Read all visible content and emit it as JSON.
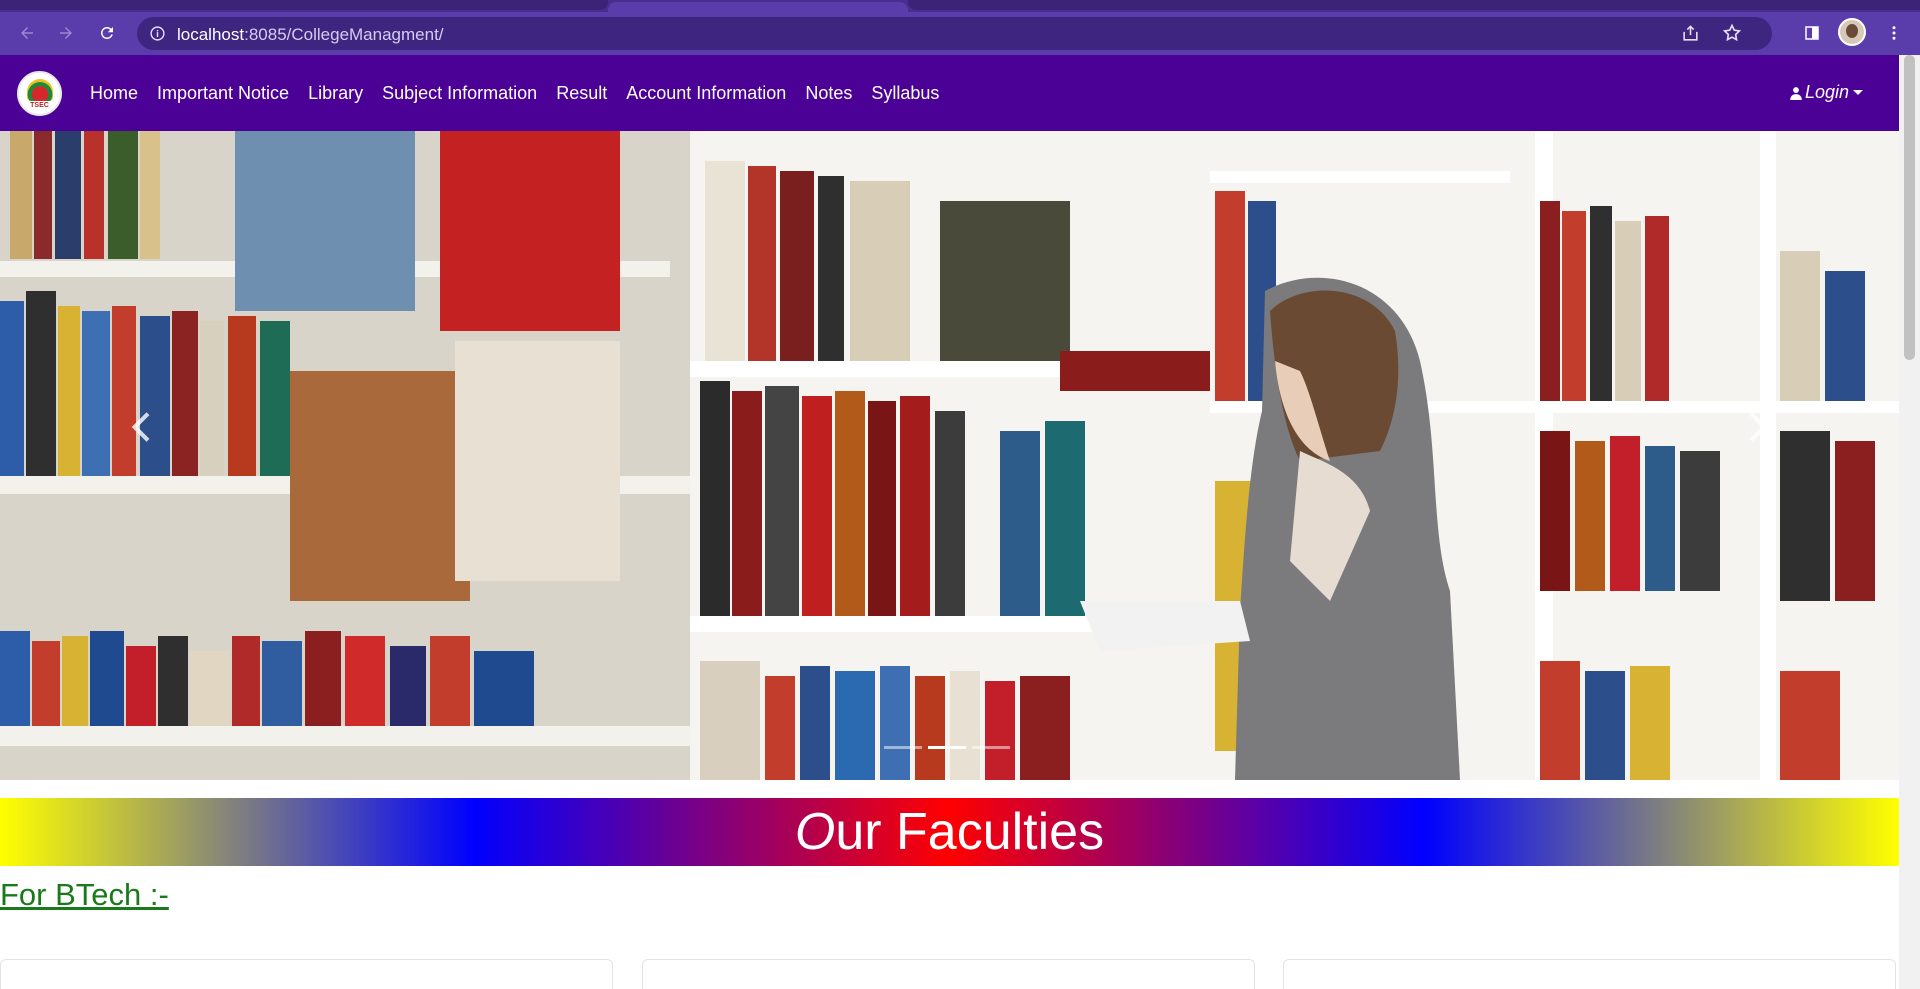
{
  "browser": {
    "url_host": "localhost",
    "url_rest": ":8085/CollegeManagment/"
  },
  "logo": {
    "text": "TSEC"
  },
  "navbar": {
    "links": [
      "Home",
      "Important Notice",
      "Library",
      "Subject Information",
      "Result",
      "Account Information",
      "Notes",
      "Syllabus"
    ],
    "login_label": "Login"
  },
  "carousel": {
    "slide_count": 3,
    "active_index": 1
  },
  "faculties": {
    "title_first": "O",
    "title_rest": "ur Faculties",
    "btech_label": "For BTech :-"
  },
  "colors": {
    "navbar": "#4b0096",
    "browser_toolbar": "#5b3cab",
    "btech_link": "#1a7a1a"
  }
}
